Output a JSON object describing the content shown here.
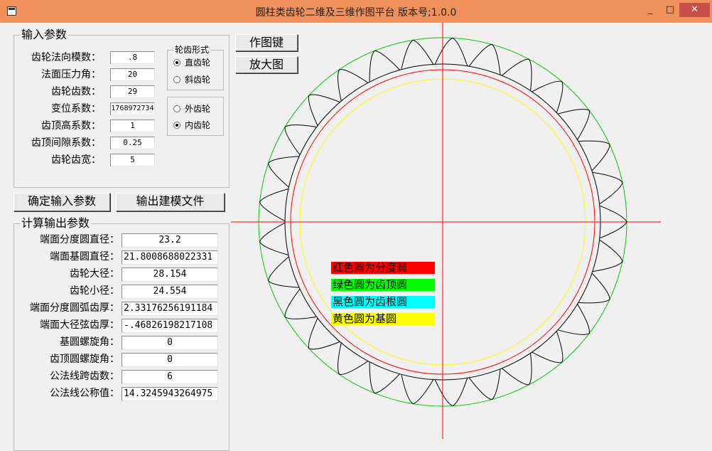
{
  "window": {
    "title": "圆柱类齿轮二维及三维作图平台 版本号;1.0.0",
    "min_glyph": "_",
    "max_glyph": "□",
    "close_glyph": "✕"
  },
  "input_group": {
    "legend": "输入参数",
    "fields": [
      {
        "label": "齿轮法向模数：",
        "value": ".8"
      },
      {
        "label": "法面压力角：",
        "value": "20"
      },
      {
        "label": "齿轮齿数：",
        "value": "29"
      },
      {
        "label": "变位系数：",
        "value": "1768972734"
      },
      {
        "label": "齿顶高系数：",
        "value": "1"
      },
      {
        "label": "齿顶间隙系数：",
        "value": "0.25"
      },
      {
        "label": "齿轮齿宽：",
        "value": "5"
      }
    ]
  },
  "tooth_form_group": {
    "legend": "轮齿形式",
    "options": [
      {
        "label": "直齿轮",
        "selected": true
      },
      {
        "label": "斜齿轮",
        "selected": false
      }
    ]
  },
  "gear_type_group": {
    "options": [
      {
        "label": "外齿轮",
        "selected": false
      },
      {
        "label": "内齿轮",
        "selected": true
      }
    ]
  },
  "buttons": {
    "draw": "作图键",
    "zoom": "放大图",
    "confirm": "确定输入参数",
    "export": "输出建模文件"
  },
  "output_group": {
    "legend": "计算输出参数",
    "fields": [
      {
        "label": "端面分度圆直径：",
        "value": "23.2"
      },
      {
        "label": "端面基圆直径：",
        "value": "21.8008688022331"
      },
      {
        "label": "齿轮大径：",
        "value": "28.154"
      },
      {
        "label": "齿轮小径：",
        "value": "24.554"
      },
      {
        "label": "端面分度圆弧齿厚：",
        "value": "2.33176256191184"
      },
      {
        "label": "端面大径弦齿厚：",
        "value": "-.46826198217108"
      },
      {
        "label": "基圆螺旋角：",
        "value": "0"
      },
      {
        "label": "齿顶圆螺旋角：",
        "value": "0"
      },
      {
        "label": "公法线跨齿数：",
        "value": "6"
      },
      {
        "label": "公法线公称值：",
        "value": "14.3245943264975"
      }
    ]
  },
  "drawing": {
    "teeth_count": 29,
    "colors": {
      "addendum_circle": "#00cc00",
      "pitch_circle": "#ff0000",
      "base_circle": "#ffff00",
      "root_circle": "#000000",
      "axes": "#ff0000"
    },
    "legend": [
      {
        "text": "红色圆为分度圆",
        "bg": "#ff0000"
      },
      {
        "text": "绿色圆为齿顶圆",
        "bg": "#00ff00"
      },
      {
        "text": "黑色圆为齿根圆",
        "bg": "#00ffff"
      },
      {
        "text": "黄色圆为基圆",
        "bg": "#ffff00"
      }
    ]
  }
}
